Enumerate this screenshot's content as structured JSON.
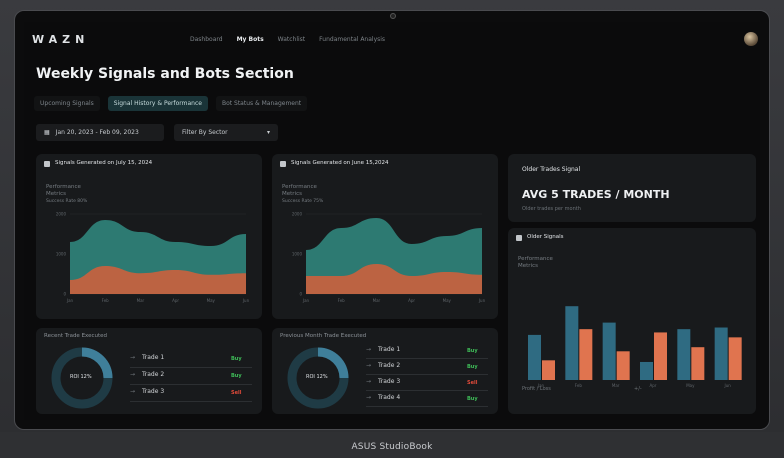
{
  "nav": {
    "logo": "WAZN",
    "links": [
      "Dashboard",
      "My Bots",
      "Watchlist",
      "Fundamental Analysis"
    ],
    "active_index": 1
  },
  "page_title": "Weekly Signals and Bots Section",
  "tabs": [
    "Upcoming Signals",
    "Signal History & Performance",
    "Bot Status & Management"
  ],
  "active_tab": 1,
  "filters": {
    "date_range": "Jan 20, 2023 - Feb 09, 2023",
    "sector": "Filter By Sector"
  },
  "signal_cards": [
    {
      "title": "Signals Generated on July 15, 2024",
      "metric_line1": "Performance",
      "metric_line2": "Metrics",
      "metric_line3": "Success Rate 80%",
      "ytick_top": "2000",
      "x_labels": [
        "Jan",
        "Feb",
        "Mar",
        "Apr",
        "May",
        "Jun"
      ]
    },
    {
      "title": "Signals Generated on June 15,2024",
      "metric_line1": "Performance",
      "metric_line2": "Metrics",
      "metric_line3": "Success Rate 75%",
      "ytick_top": "2000",
      "x_labels": [
        "Jan",
        "Feb",
        "Mar",
        "Apr",
        "May",
        "Jun"
      ]
    }
  ],
  "older_trades_signal": {
    "title": "Older Trades Signal",
    "headline": "AVG 5 TRADES / MONTH",
    "sub": "Older trades per month"
  },
  "older_signals": {
    "title": "Older Signals",
    "metric_line1": "Performance",
    "metric_line2": "Metrics",
    "x_labels": [
      "Jan",
      "Feb",
      "Mar",
      "Apr",
      "May",
      "Jun"
    ],
    "footer_left": "Profit / Loss",
    "footer_right": "+/-"
  },
  "recent_trades": {
    "title": "Recent Trade Executed",
    "donut_label": "ROI 12%",
    "items": [
      {
        "name": "Trade 1",
        "action": "Buy"
      },
      {
        "name": "Trade 2",
        "action": "Buy"
      },
      {
        "name": "Trade 3",
        "action": "Sell"
      }
    ]
  },
  "previous_trades": {
    "title": "Previous Month Trade Executed",
    "donut_label": "ROI 12%",
    "items": [
      {
        "name": "Trade 1",
        "action": "Buy"
      },
      {
        "name": "Trade 2",
        "action": "Buy"
      },
      {
        "name": "Trade 3",
        "action": "Sell"
      },
      {
        "name": "Trade 4",
        "action": "Buy"
      }
    ]
  },
  "laptop_brand": "ASUS StudioBook",
  "colors": {
    "teal": "#2e7f77",
    "rust": "#c4623f",
    "bar_blue": "#2f6b82",
    "bar_orange": "#e0744f",
    "buy": "#3fbf59",
    "sell": "#e04a3a"
  },
  "chart_data": [
    {
      "type": "area",
      "title": "Signals Generated on July 15, 2024",
      "categories": [
        "Jan",
        "Feb",
        "Mar",
        "Apr",
        "May",
        "Jun"
      ],
      "series": [
        {
          "values": [
            1300,
            1850,
            1550,
            1300,
            1200,
            1500
          ]
        },
        {
          "values": [
            350,
            700,
            520,
            600,
            480,
            520
          ]
        }
      ],
      "ylim": [
        0,
        2000
      ]
    },
    {
      "type": "area",
      "title": "Signals Generated on June 15,2024",
      "categories": [
        "Jan",
        "Feb",
        "Mar",
        "Apr",
        "May",
        "Jun"
      ],
      "series": [
        {
          "values": [
            1100,
            1650,
            1900,
            1250,
            1450,
            1650
          ]
        },
        {
          "values": [
            450,
            450,
            750,
            450,
            550,
            480
          ]
        }
      ],
      "ylim": [
        0,
        2000
      ]
    },
    {
      "type": "bar",
      "title": "Older Signals",
      "categories": [
        "Jan",
        "Feb",
        "Mar",
        "Apr",
        "May",
        "Jun"
      ],
      "series": [
        {
          "values": [
            55,
            90,
            70,
            22,
            62,
            64
          ]
        },
        {
          "values": [
            24,
            62,
            35,
            58,
            40,
            52
          ]
        }
      ],
      "ylim": [
        0,
        100
      ]
    }
  ]
}
